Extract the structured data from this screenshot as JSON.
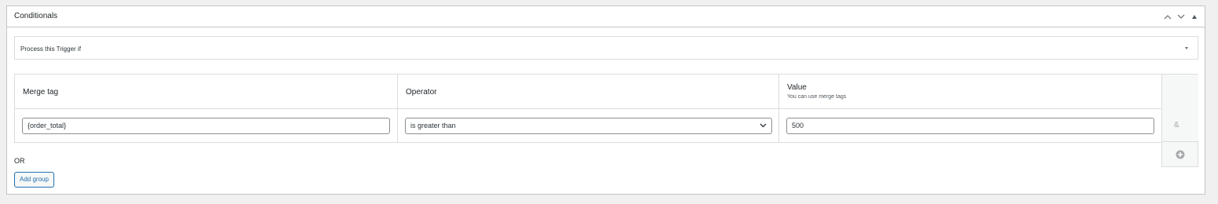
{
  "panel": {
    "title": "Conditionals",
    "controls": [
      "chevron-up-icon",
      "chevron-down-icon",
      "triangle-up-icon"
    ]
  },
  "trigger_select": {
    "selected": "Process this Trigger if"
  },
  "table": {
    "headers": {
      "merge_tag": "Merge tag",
      "operator": "Operator",
      "value": "Value",
      "value_hint": "You can use merge tags"
    },
    "rows": [
      {
        "merge_tag": "{order_total}",
        "operator": "is greater than",
        "value": "500"
      }
    ],
    "and_label": "&"
  },
  "or_label": "OR",
  "add_group_label": "Add group",
  "colors": {
    "accent": "#2271b1",
    "border": "#c3c4c7",
    "background": "#f0f0f1"
  }
}
